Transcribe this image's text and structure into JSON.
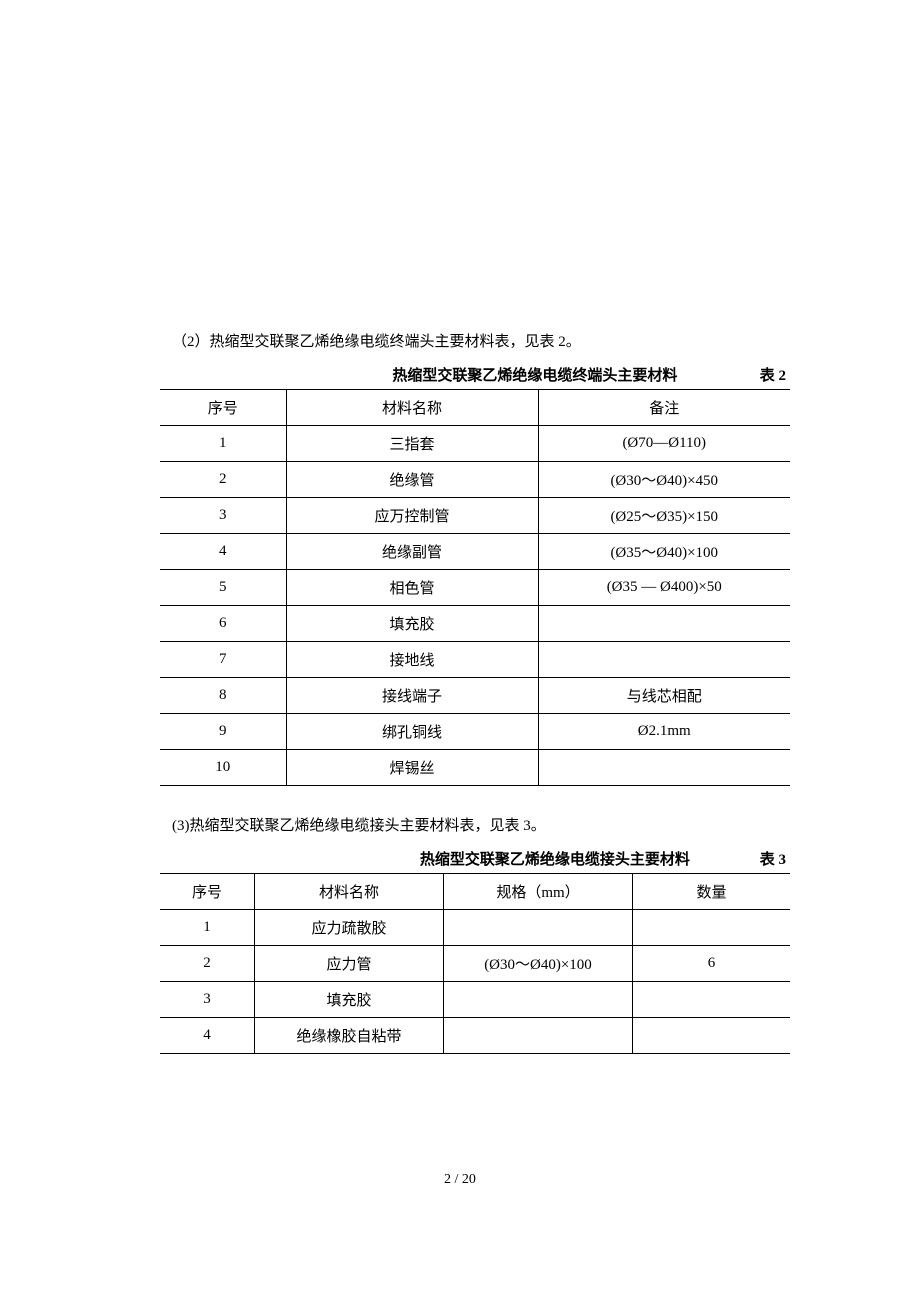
{
  "section2": {
    "intro": "（2）热缩型交联聚乙烯绝缘电缆终端头主要材料表，见表 2。",
    "caption_title": "热缩型交联聚乙烯绝缘电缆终端头主要材料",
    "caption_num": "表 2",
    "headers": {
      "col1": "序号",
      "col2": "材料名称",
      "col3": "备注"
    },
    "rows": [
      {
        "no": "1",
        "name": "三指套",
        "note": "(Ø70—Ø110)"
      },
      {
        "no": "2",
        "name": "绝缘管",
        "note": "(Ø30～Ø40)×450"
      },
      {
        "no": "3",
        "name": "应万控制管",
        "note": "(Ø25～Ø35)×150"
      },
      {
        "no": "4",
        "name": "绝缘副管",
        "note": "(Ø35～Ø40)×100"
      },
      {
        "no": "5",
        "name": "相色管",
        "note": "(Ø35 — Ø400)×50"
      },
      {
        "no": "6",
        "name": "填充胶",
        "note": ""
      },
      {
        "no": "7",
        "name": "接地线",
        "note": ""
      },
      {
        "no": "8",
        "name": "接线端子",
        "note": "与线芯相配"
      },
      {
        "no": "9",
        "name": "绑孔铜线",
        "note": "Ø2.1mm"
      },
      {
        "no": "10",
        "name": "焊锡丝",
        "note": ""
      }
    ]
  },
  "section3": {
    "intro": "(3)热缩型交联聚乙烯绝缘电缆接头主要材料表，见表 3。",
    "caption_title": "热缩型交联聚乙烯绝缘电缆接头主要材料",
    "caption_num": "表 3",
    "headers": {
      "col1": "序号",
      "col2": "材料名称",
      "col3": "规格（mm）",
      "col4": "数量"
    },
    "rows": [
      {
        "no": "1",
        "name": "应力疏散胶",
        "spec": "",
        "qty": ""
      },
      {
        "no": "2",
        "name": "应力管",
        "spec": "(Ø30～Ø40)×100",
        "qty": "6"
      },
      {
        "no": "3",
        "name": "填充胶",
        "spec": "",
        "qty": ""
      },
      {
        "no": "4",
        "name": "绝缘橡胶自粘带",
        "spec": "",
        "qty": ""
      }
    ]
  },
  "page_number": "2 / 20"
}
